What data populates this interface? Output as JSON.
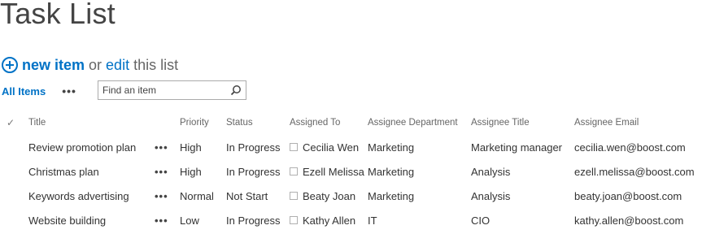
{
  "page": {
    "title": "Task List"
  },
  "actions": {
    "new_item": "new item",
    "or": "or",
    "edit": "edit",
    "this_list": "this list"
  },
  "view": {
    "name": "All Items",
    "more": "•••"
  },
  "search": {
    "placeholder": "Find an item"
  },
  "table": {
    "headers": {
      "check": "✓",
      "title": "Title",
      "priority": "Priority",
      "status": "Status",
      "assigned_to": "Assigned To",
      "department": "Assignee Department",
      "job_title": "Assignee Title",
      "email": "Assignee Email"
    },
    "row_menu": "•••",
    "rows": [
      {
        "title": "Review promotion plan",
        "priority": "High",
        "status": "In Progress",
        "assigned_to": "Cecilia Wen",
        "department": "Marketing",
        "job_title": "Marketing manager",
        "email": "cecilia.wen@boost.com"
      },
      {
        "title": "Christmas plan",
        "priority": "High",
        "status": "In Progress",
        "assigned_to": "Ezell Melissa",
        "department": "Marketing",
        "job_title": "Analysis",
        "email": "ezell.melissa@boost.com"
      },
      {
        "title": "Keywords advertising",
        "priority": "Normal",
        "status": "Not Start",
        "assigned_to": "Beaty Joan",
        "department": "Marketing",
        "job_title": "Analysis",
        "email": "beaty.joan@boost.com"
      },
      {
        "title": "Website building",
        "priority": "Low",
        "status": "In Progress",
        "assigned_to": "Kathy Allen",
        "department": "IT",
        "job_title": "CIO",
        "email": "kathy.allen@boost.com"
      }
    ]
  },
  "colors": {
    "link": "#0072c6",
    "text": "#333333",
    "header_text": "#666666"
  }
}
